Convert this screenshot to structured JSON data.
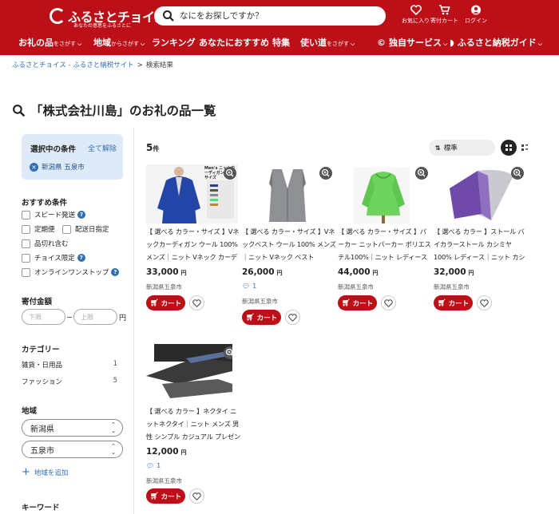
{
  "header": {
    "logo": "ふるさとチョイス",
    "logo_sub": "あなたの意思をふるさとに",
    "search_placeholder": "なにをお探しですか？",
    "icons": [
      {
        "label": "お気に入り",
        "icon": "heart-icon"
      },
      {
        "label": "寄付カート",
        "icon": "cart-icon"
      },
      {
        "label": "ログイン",
        "icon": "user-icon"
      }
    ],
    "nav": [
      {
        "main": "お礼の品",
        "sub": "をさがす"
      },
      {
        "main": "地域",
        "sub": "からさがす"
      },
      {
        "main": "ランキング",
        "sub": ""
      },
      {
        "main": "あなたにおすすめ",
        "sub": ""
      },
      {
        "main": "特集",
        "sub": ""
      },
      {
        "main": "使い道",
        "sub": "をさがす"
      },
      {
        "main": "独自サービス",
        "sub": ""
      },
      {
        "main": "ふるさと納税ガイド",
        "sub": ""
      }
    ]
  },
  "breadcrumb": {
    "home": "ふるさとチョイス - ふるさと納税サイト",
    "sep": ">",
    "current": "検索結果"
  },
  "page_title": "「株式会社川島」のお礼の品一覧",
  "sidebar": {
    "selected_heading": "選択中の条件",
    "clear_all": "全て解除",
    "selected_chip": "新潟県 五泉市",
    "recommended_heading": "おすすめ条件",
    "checkboxes": [
      "スピード発送",
      "定期便",
      "配送日指定",
      "品切れ含む",
      "チョイス限定",
      "オンラインワンストップ"
    ],
    "amount_heading": "寄付金額",
    "amount_min_placeholder": "下限",
    "amount_max_placeholder": "上限",
    "amount_unit": "円",
    "category_heading": "カテゴリー",
    "categories": [
      {
        "name": "雑貨・日用品",
        "count": "1"
      },
      {
        "name": "ファッション",
        "count": "5"
      }
    ],
    "region_heading": "地域",
    "prefecture": "新潟県",
    "city": "五泉市",
    "add_area": "地域を追加",
    "keyword_heading": "キーワード"
  },
  "results": {
    "count": "5",
    "count_unit": "件",
    "sort_label": "標準",
    "items": [
      {
        "title": "【 選べる カラー・サイズ 】Vネックカーディガン ウール 100% メンズ｜ニット Vネック カーディガン",
        "price": "33,000",
        "price_unit": "円",
        "comments": "",
        "location": "新潟県五泉市",
        "cart": "カート",
        "image_label": "Men's ニットカーディガン M・Lサイズ"
      },
      {
        "title": "【 選べる カラー・サイズ 】Vネックベスト ウール 100% メンズ｜ニット Vネック ベスト",
        "price": "26,000",
        "price_unit": "円",
        "comments": "1",
        "location": "新潟県五泉市",
        "cart": "カート"
      },
      {
        "title": "【 選べる カラー・サイズ 】パーカー ニットパーカー ポリエステル100%｜ニット レディース",
        "price": "44,000",
        "price_unit": "円",
        "comments": "",
        "location": "新潟県五泉市",
        "cart": "カート"
      },
      {
        "title": "【 選べる カラー 】ストール バイカラーストール カシミヤ100% レディース｜ニット カシミヤ",
        "price": "32,000",
        "price_unit": "円",
        "comments": "",
        "location": "新潟県五泉市",
        "cart": "カート"
      },
      {
        "title": "【 選べる カラー 】ネクタイ ニットネクタイ｜ニット メンズ 男性 シンプル カジュアル プレゼント",
        "price": "12,000",
        "price_unit": "円",
        "comments": "1",
        "location": "新潟県五泉市",
        "cart": "カート"
      }
    ]
  }
}
